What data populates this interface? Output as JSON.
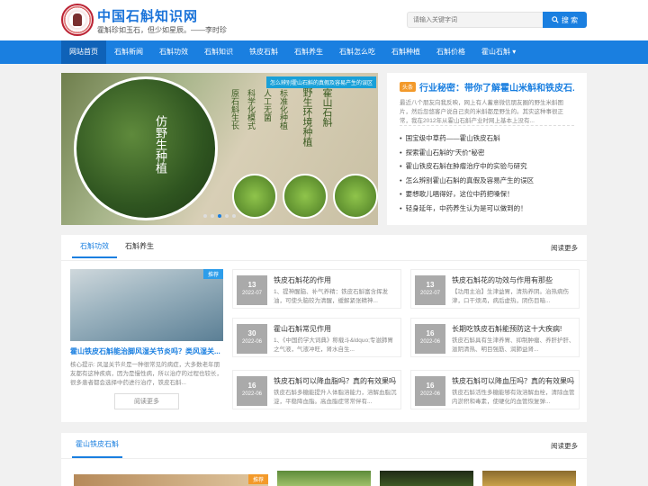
{
  "header": {
    "title": "中国石斛知识网",
    "slogan": "霍斛珍如玉石，但少如星辰。——李时珍",
    "search_placeholder": "请输入关键字词",
    "search_button": "搜 索"
  },
  "nav": [
    "网站首页",
    "石斛新闻",
    "石斛功效",
    "石斛知识",
    "铁皮石斛",
    "石斛养生",
    "石斛怎么吃",
    "石斛种植",
    "石斛价格",
    "霍山石斛 ▾"
  ],
  "slider": {
    "banner": "怎么辨别霍山石斛的真假及容易产生的误区",
    "circle_text": "仿野生种植",
    "col1": "霍山石斛",
    "col2": "野生环境种植",
    "col3": "标准化种植",
    "col4": "人工无菌",
    "col5": "科学化模式",
    "col6": "原石斛生长"
  },
  "headline": {
    "tag": "头条",
    "title": "行业秘密：带你了解霍山米斛和铁皮石...",
    "summary": "最近八个朋友向我反映，网上有人蓄意微信朋友圈的野生米斛图片，然后忽悠客户说自己卖的米斛都是野生的。其实这种事很正常，我在2012年从霍山石斛产业时网上基本上没有...",
    "items": [
      "国宝级中草药——霍山铁皮石斛",
      "探索霍山石斛的\"天价\"秘密",
      "霍山铁皮石斛在肿瘤治疗中的实验与研究",
      "怎么辨别霍山石斛的真假及容易产生的误区",
      "要想歌儿唱得好，这位中药把嗓保！",
      "轻身延年，中药养生认为是可以做到的！"
    ]
  },
  "section1": {
    "tabs": [
      "石斛功效",
      "石斛养生"
    ],
    "more": "阅读更多",
    "feature": {
      "badge": "推荐",
      "title": "霍山铁皮石斛能治脚风湿关节炎吗？类风湿关...",
      "desc": "核心提示: 风湿关节炎是一种很常见的病症，大多数老年朋友都有这种疾病，因为是慢性病，所以治疗的过程也较长，很多患者都会选择中药进行治疗，铁皮石斛...",
      "button": "阅读更多"
    },
    "cards": [
      {
        "day": "13",
        "month": "2022-07",
        "title": "铁皮石斛花的作用",
        "desc": "1、提神醒脑、补气养精：铁皮石斛富含挥发油，可使头脑较为清醒，缓解紧张精神..."
      },
      {
        "day": "13",
        "month": "2022-07",
        "title": "铁皮石斛花的功效与作用有那些",
        "desc": "【功用主治】生津益胃，清热养阴。治热病伤津，口干烦渴，病后虚热，阴伤目暗..."
      },
      {
        "day": "30",
        "month": "2022-06",
        "title": "霍山石斛常见作用",
        "desc": "1、《中国药学大词典》称载斗&ldquo;专滋肺胃之气液，气液冲旺，肾水自生..."
      },
      {
        "day": "16",
        "month": "2022-06",
        "title": "长期吃铁皮石斛能预防这十大疾病!",
        "desc": "铁皮石斛具有生津养胃、抑制肿瘤、养肝护肝、滋阴清热、明目强筋、润肺益肾..."
      },
      {
        "day": "16",
        "month": "2022-06",
        "title": "铁皮石斛可以降血脂吗？真的有效果吗",
        "desc": "铁皮石斛多糖能提升人体脂溶能力，溶解血脂沉淀，平稳降血脂。高血脂症常常伴有..."
      },
      {
        "day": "16",
        "month": "2022-06",
        "title": "铁皮石斛可以降血压吗？真的有效果吗",
        "desc": "铁皮石斛活性多糖能够有效溶解血栓，清除血管内淤积和毒素，使硬化的血管恢复弹..."
      }
    ]
  },
  "section2": {
    "tab": "霍山铁皮石斛",
    "more": "阅读更多",
    "badge": "推荐"
  }
}
